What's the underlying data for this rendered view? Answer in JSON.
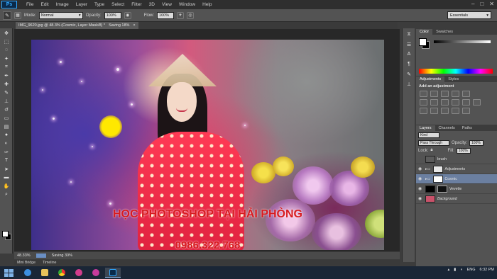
{
  "menu": {
    "logo": "Ps",
    "items": [
      "File",
      "Edit",
      "Image",
      "Layer",
      "Type",
      "Select",
      "Filter",
      "3D",
      "View",
      "Window",
      "Help"
    ],
    "window_buttons": [
      "–",
      "□",
      "✕"
    ]
  },
  "options_bar": {
    "mode_label": "Mode:",
    "mode_value": "Normal",
    "opacity_label": "Opacity:",
    "opacity_value": "100%",
    "flow_label": "Flow:",
    "flow_value": "100%",
    "workspace": "Essentials"
  },
  "document": {
    "tab_title": "IMG_9620.jpg @ 48.3% (Cosmic, Layer Mask/8) *",
    "tab_status": "Saving 18%",
    "close": "×"
  },
  "canvas": {
    "title_text": "HỌC PHOTOSHOP TẠI HẢI PHÒNG",
    "phone_text": "0986.322.768"
  },
  "status_bar": {
    "zoom": "48.33%",
    "saving": "Saving 30%"
  },
  "bottom_tabs": [
    "Mini Bridge",
    "Timeline"
  ],
  "panels": {
    "color_tabs": [
      "Color",
      "Swatches"
    ],
    "adjustments_tabs": [
      "Adjustments",
      "Styles"
    ],
    "adjustments_title": "Add an adjustment",
    "layers_tabs": [
      "Layers",
      "Channels",
      "Paths"
    ],
    "filter_label": "Kind",
    "blend_mode": "Pass Through",
    "opacity_label": "Opacity:",
    "opacity_value": "100%",
    "lock_label": "Lock:",
    "fill_label": "Fill:",
    "fill_value": "100%",
    "layers": [
      {
        "name": "brush",
        "thumb": "#5b5b5b",
        "visible": false,
        "selected": false
      },
      {
        "name": "Adjustments",
        "thumb": "#e8e8e8",
        "visible": true,
        "selected": false
      },
      {
        "name": "Cosmic",
        "thumb": "#ffffff",
        "visible": true,
        "selected": true
      },
      {
        "name": "Vevette",
        "thumb": "#000000",
        "visible": true,
        "selected": false
      },
      {
        "name": "Background",
        "thumb": "#c9526a",
        "visible": true,
        "selected": false
      }
    ]
  },
  "taskbar": {
    "lang": "ENG",
    "time": "6:32 PM"
  },
  "colors": {
    "accent": "#31a8ff",
    "overlay_text": "#d81b20",
    "selected_layer": "#6b7fa0"
  }
}
